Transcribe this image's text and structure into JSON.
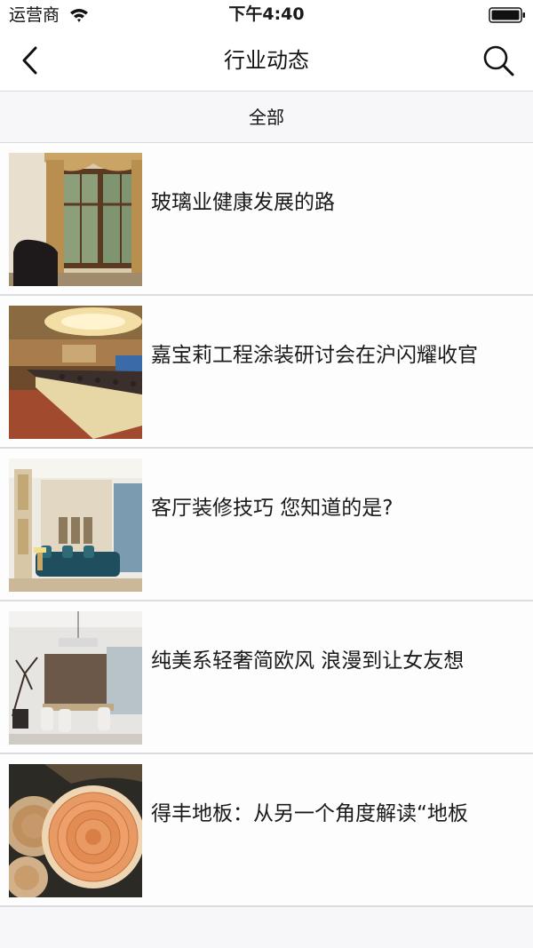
{
  "status_bar": {
    "carrier": "运营商",
    "time": "下午4:40"
  },
  "nav": {
    "title": "行业动态",
    "back_icon": "chevron-left-icon",
    "search_icon": "search-icon"
  },
  "filter": {
    "label": "全部"
  },
  "news": [
    {
      "title": "玻璃业健康发展的路",
      "image": "living-room-window-photo"
    },
    {
      "title": "嘉宝莉工程涂装研讨会在沪闪耀收官",
      "image": "conference-hall-photo"
    },
    {
      "title": "客厅装修技巧 您知道的是?",
      "image": "classic-living-room-photo"
    },
    {
      "title": "纯美系轻奢简欧风 浪漫到让女友想",
      "image": "dining-room-photo"
    },
    {
      "title": "得丰地板：从另一个角度解读“地板",
      "image": "wood-log-rings-photo"
    }
  ],
  "colors": {
    "bar_background": "#ffffff",
    "page_background": "#f7f7f9",
    "divider": "#d9d9de"
  }
}
